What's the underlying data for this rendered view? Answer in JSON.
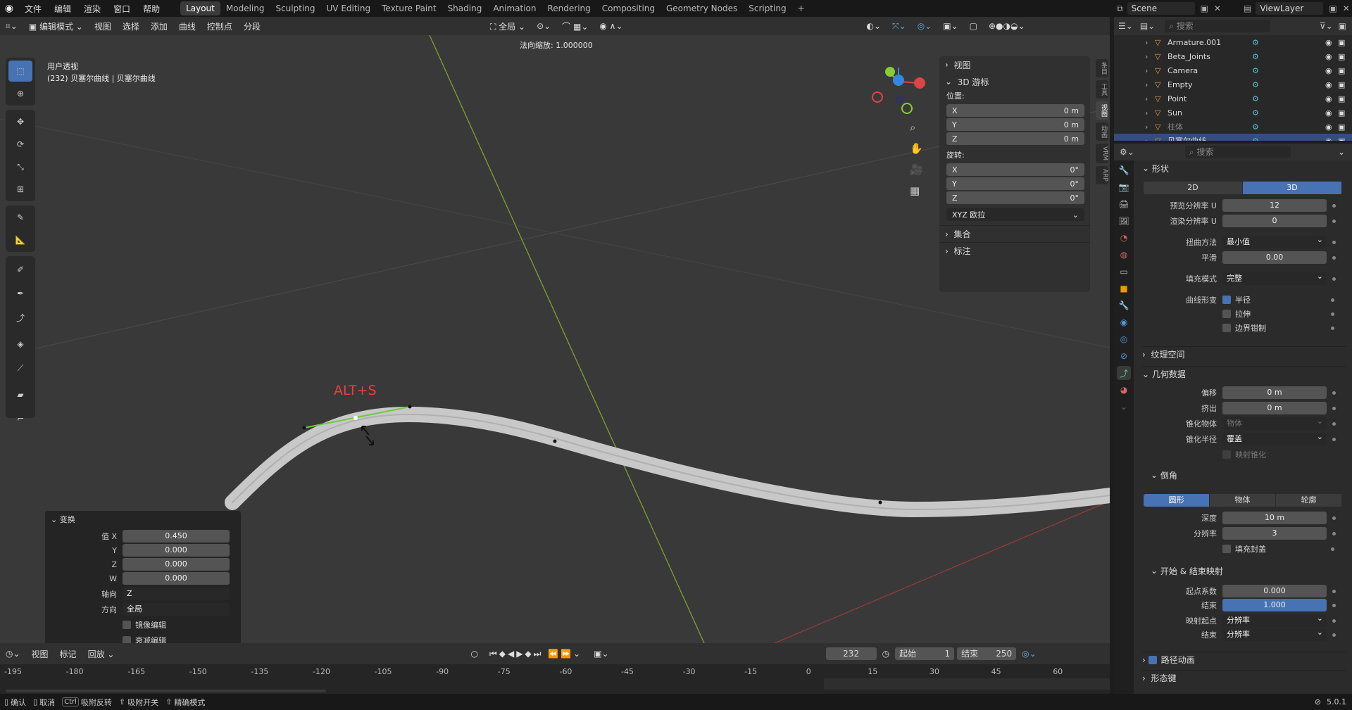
{
  "topbar": {
    "menus": [
      "文件",
      "编辑",
      "渲染",
      "窗口",
      "帮助"
    ],
    "workspaces": [
      "Layout",
      "Modeling",
      "Sculpting",
      "UV Editing",
      "Texture Paint",
      "Shading",
      "Animation",
      "Rendering",
      "Compositing",
      "Geometry Nodes",
      "Scripting"
    ],
    "active_workspace": "Layout",
    "add_tab": "+",
    "scene": "Scene",
    "view_layer": "ViewLayer"
  },
  "viewport_header": {
    "mode": "编辑模式",
    "menus": [
      "视图",
      "选择",
      "添加",
      "曲线",
      "控制点",
      "分段"
    ],
    "transform_orientation": "全局"
  },
  "viewport": {
    "operator_hint": "法向缩放: 1.000000",
    "view_name": "用户透视",
    "object_info": "(232) 贝塞尔曲线 | 贝塞尔曲线",
    "annotation": "ALT+S",
    "annotation_color": "#e8413a"
  },
  "npanel": {
    "sections": {
      "view": "视图",
      "cursor": "3D 游标",
      "collection": "集合",
      "annotation": "标注"
    },
    "location_label": "位置:",
    "location": [
      {
        "axis": "X",
        "value": "0 m"
      },
      {
        "axis": "Y",
        "value": "0 m"
      },
      {
        "axis": "Z",
        "value": "0 m"
      }
    ],
    "rotation_label": "旋转:",
    "rotation": [
      {
        "axis": "X",
        "value": "0°"
      },
      {
        "axis": "Y",
        "value": "0°"
      },
      {
        "axis": "Z",
        "value": "0°"
      }
    ],
    "rotation_mode": "XYZ 欧拉",
    "side_tabs": [
      "条目",
      "工具",
      "视图",
      "动画",
      "VRM",
      "ARP"
    ]
  },
  "last_operator": {
    "title": "变换",
    "values": [
      {
        "label": "值 X",
        "value": "0.450"
      },
      {
        "label": "Y",
        "value": "0.000"
      },
      {
        "label": "Z",
        "value": "0.000"
      },
      {
        "label": "W",
        "value": "0.000"
      }
    ],
    "axis_label": "轴向",
    "axis_value": "Z",
    "orientation_label": "方向",
    "orientation_value": "全局",
    "mirror": "镜像编辑",
    "falloff": "衰减编辑"
  },
  "timeline": {
    "menus": [
      "视图",
      "标记"
    ],
    "playback": "回放",
    "current_frame": "232",
    "start_label": "起始",
    "start": "1",
    "end_label": "结束",
    "end": "250",
    "ticks": [
      "-195",
      "-180",
      "-165",
      "-150",
      "-135",
      "-120",
      "-105",
      "-90",
      "-75",
      "-60",
      "-45",
      "-30",
      "-15",
      "0",
      "15",
      "30",
      "45",
      "60"
    ]
  },
  "statusbar": {
    "items": [
      "确认",
      "取消",
      "吸附反转",
      "吸附开关",
      "精确模式"
    ],
    "ctrl_key": "Ctrl",
    "version": "5.0.1"
  },
  "outliner": {
    "search_placeholder": "搜索",
    "rows": [
      {
        "name": "Armature.001",
        "color": "#e6a046"
      },
      {
        "name": "Beta_Joints",
        "color": "#e6a046"
      },
      {
        "name": "Camera",
        "color": "#e6a046"
      },
      {
        "name": "Empty",
        "color": "#e6a046"
      },
      {
        "name": "Point",
        "color": "#e6a046"
      },
      {
        "name": "Sun",
        "color": "#e6a046"
      },
      {
        "name": "柱体",
        "color": "#e6a046"
      },
      {
        "name": "贝塞尔曲线",
        "color": "#e6a046"
      }
    ]
  },
  "properties": {
    "search_placeholder": "搜索",
    "shape": {
      "title": "形状",
      "dim_2d": "2D",
      "dim_3d": "3D",
      "preview_res_label": "预览分辨率 U",
      "preview_res": "12",
      "render_res_label": "渲染分辨率 U",
      "render_res": "0",
      "twist_label": "扭曲方法",
      "twist": "最小值",
      "smooth_label": "平滑",
      "smooth": "0.00",
      "fill_label": "填充模式",
      "fill": "完整",
      "deform_label": "曲线形变",
      "radius": "半径",
      "stretch": "拉伸",
      "clamp": "边界钳制"
    },
    "texture_space": "纹理空间",
    "geometry": {
      "title": "几何数据",
      "offset_label": "偏移",
      "offset": "0 m",
      "extrude_label": "挤出",
      "extrude": "0 m",
      "taper_obj_label": "锥化物体",
      "taper_obj_placeholder": "物体",
      "taper_radius_label": "锥化半径",
      "taper_radius": "覆盖",
      "map_taper": "映射锥化"
    },
    "bevel": {
      "title": "倒角",
      "modes": [
        "圆形",
        "物体",
        "轮廓"
      ],
      "depth_label": "深度",
      "depth": "10 m",
      "resolution_label": "分辨率",
      "resolution": "3",
      "fill_caps": "填充封盖"
    },
    "mapping": {
      "title": "开始 & 结束映射",
      "factor_start_label": "起点系数",
      "factor_start": "0.000",
      "factor_end_label": "结束",
      "factor_end": "1.000",
      "map_start_label": "映射起点",
      "map_start": "分辨率",
      "map_end_label": "结束",
      "map_end": "分辨率"
    },
    "path_anim": "路径动画",
    "shape_keys": "形态键"
  }
}
